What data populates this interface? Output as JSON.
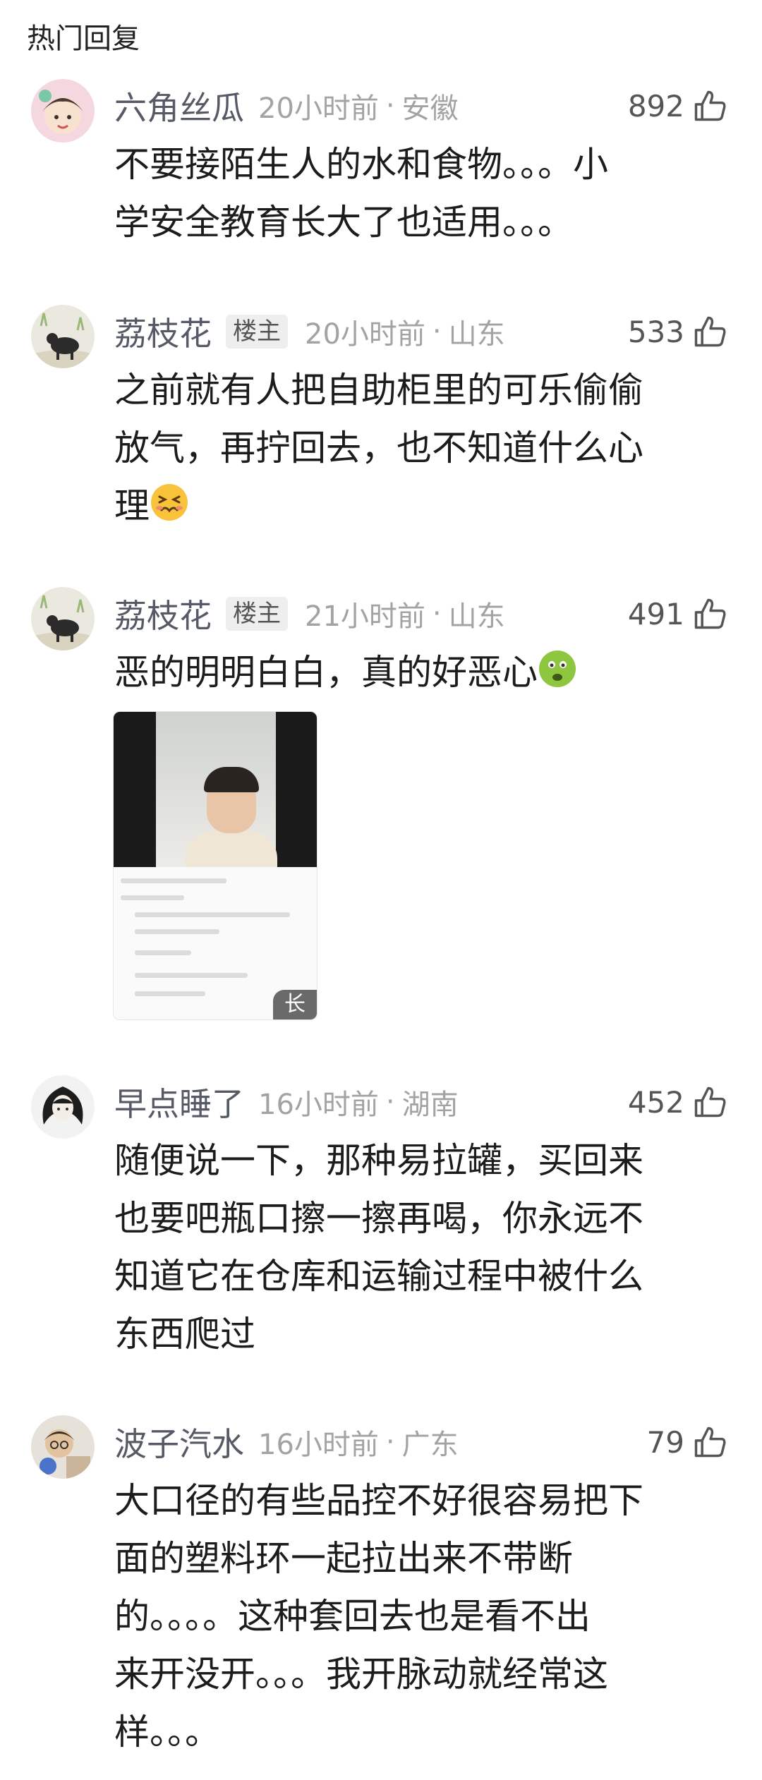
{
  "section_title": "热门回复",
  "op_badge": "楼主",
  "comments": [
    {
      "username": "六角丝瓜",
      "time": "20小时前",
      "location": "安徽",
      "likes": "892",
      "text_lines": [
        "不要接陌生人的水和食物。。。小",
        "学安全教育长大了也适用。。。"
      ]
    },
    {
      "username": "荔枝花",
      "is_op": true,
      "time": "20小时前",
      "location": "山东",
      "likes": "533",
      "text_lines": [
        "之前就有人把自助柜里的可乐偷偷",
        "放气，再拧回去，也不知道什么心",
        "理"
      ],
      "emoji": "tired-face"
    },
    {
      "username": "荔枝花",
      "is_op": true,
      "time": "21小时前",
      "location": "山东",
      "likes": "491",
      "text_lines": [
        "恶的明明白白，真的好恶心"
      ],
      "emoji": "nauseated-face",
      "image_badge": "长"
    },
    {
      "username": "早点睡了",
      "time": "16小时前",
      "location": "湖南",
      "likes": "452",
      "text_lines": [
        "随便说一下，那种易拉罐，买回来",
        "也要吧瓶口擦一擦再喝，你永远不",
        "知道它在仓库和运输过程中被什么",
        "东西爬过"
      ]
    },
    {
      "username": "波子汽水",
      "time": "16小时前",
      "location": "广东",
      "likes": "79",
      "text_lines": [
        "大口径的有些品控不好很容易把下",
        "面的塑料环一起拉出来不带断",
        "的。。。。这种套回去也是看不出",
        "来开没开。。。我开脉动就经常这",
        "样。。。"
      ]
    }
  ],
  "separator": "·",
  "colors": {
    "username": "#555a66",
    "meta": "#a3a3a3",
    "text": "#1c1c1c"
  }
}
